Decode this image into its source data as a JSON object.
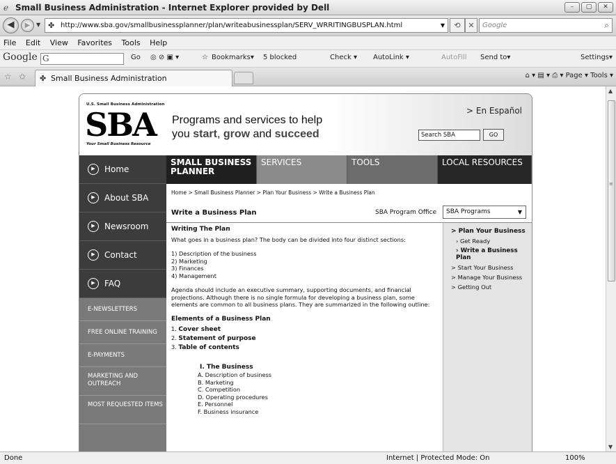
{
  "window": {
    "title": "Small Business Administration - Internet Explorer provided by Dell",
    "min": "–",
    "max": "▢",
    "close": "✕"
  },
  "address": {
    "url": "http://www.sba.gov/smallbusinessplanner/plan/writeabusinessplan/SERV_WRRITINGBUSPLAN.html",
    "search_placeholder": "Google"
  },
  "menu": [
    "File",
    "Edit",
    "View",
    "Favorites",
    "Tools",
    "Help"
  ],
  "google_toolbar": {
    "logo": "Google",
    "go": "Go",
    "bookmarks": "Bookmarks▾",
    "blocked": "5 blocked",
    "check": "Check ▾",
    "autolink": "AutoLink ▾",
    "autofill": "AutoFill",
    "sendto": "Send to▾",
    "settings": "Settings▾"
  },
  "tabs": {
    "active_label": "Small Business Administration",
    "commands": "⌂ ▾  ▤ ▾  ⎙ ▾  Page ▾  Tools ▾"
  },
  "status": {
    "left": "Done",
    "zone": "Internet | Protected Mode: On",
    "zoom": "100%"
  },
  "sba": {
    "logo_agency": "U.S. Small Business Administration",
    "logo_text": "SBA",
    "logo_tagline": "Your Small Business Resource",
    "tagline_line1": "Programs and services to help",
    "tagline_you": "you ",
    "tagline_start": "start",
    "tagline_comma": ", ",
    "tagline_grow": "grow",
    "tagline_and": " and ",
    "tagline_succeed": "succeed",
    "espanol": "> En Español",
    "search_value": "Search SBA",
    "search_go": "GO",
    "left_nav": [
      {
        "label": "Home"
      },
      {
        "label": "About SBA"
      },
      {
        "label": "Newsroom"
      },
      {
        "label": "Contact"
      },
      {
        "label": "FAQ"
      }
    ],
    "left_sub": [
      "E-NEWSLETTERS",
      "FREE ONLINE TRAINING",
      "E-PAYMENTS",
      "MARKETING AND OUTREACH",
      "MOST REQUESTED ITEMS"
    ],
    "top_nav": [
      "SMALL BUSINESS PLANNER",
      "SERVICES",
      "TOOLS",
      "LOCAL RESOURCES"
    ],
    "breadcrumb": "Home > Small Business Planner > Plan Your Business > Write a Business Plan",
    "page_title": "Write a Business Plan",
    "office_label": "SBA Program Office",
    "office_value": "SBA Programs",
    "right_nav": [
      "> Plan Your Business",
      "› Get Ready",
      "› Write a Business Plan",
      "> Start Your Business",
      "> Manage Your Business",
      "> Getting Out"
    ],
    "body": {
      "heading": "Writing The Plan",
      "intro": "What goes in a business plan? The body can be divided into four distinct sections:",
      "sections": [
        "1) Description of the business",
        "2) Marketing",
        "3) Finances",
        "4) Management"
      ],
      "agenda": "Agenda should include an executive summary, supporting documents, and financial projections. Although there is no single formula for developing a business plan, some elements are common to all business plans. They are summarized in the following outline:",
      "elements_heading": "Elements of a Business Plan",
      "elements": [
        {
          "num": "1. ",
          "label": "Cover sheet"
        },
        {
          "num": "2. ",
          "label": "Statement of purpose"
        },
        {
          "num": "3. ",
          "label": "Table of contents"
        }
      ],
      "outline_heading": "I. The Business",
      "outline_items": [
        "A. Description of business",
        "B. Marketing",
        "C. Competition",
        "D. Operating procedures",
        "E. Personnel",
        "F. Business insurance"
      ]
    }
  }
}
